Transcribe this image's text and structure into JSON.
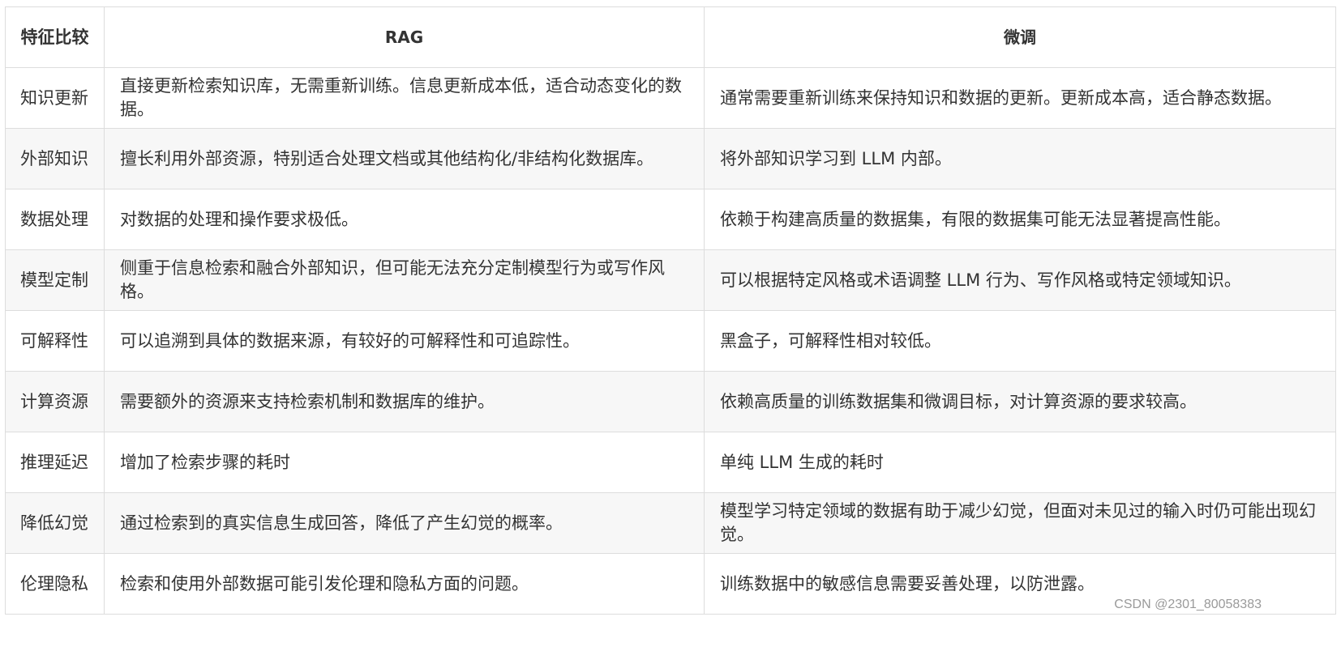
{
  "table": {
    "headers": [
      "特征比较",
      "RAG",
      "微调"
    ],
    "rows": [
      {
        "feature": "知识更新",
        "rag": "直接更新检索知识库，无需重新训练。信息更新成本低，适合动态变化的数据。",
        "ft": "通常需要重新训练来保持知识和数据的更新。更新成本高，适合静态数据。"
      },
      {
        "feature": "外部知识",
        "rag": "擅长利用外部资源，特别适合处理文档或其他结构化/非结构化数据库。",
        "ft": "将外部知识学习到 LLM 内部。"
      },
      {
        "feature": "数据处理",
        "rag": "对数据的处理和操作要求极低。",
        "ft": "依赖于构建高质量的数据集，有限的数据集可能无法显著提高性能。"
      },
      {
        "feature": "模型定制",
        "rag": "侧重于信息检索和融合外部知识，但可能无法充分定制模型行为或写作风格。",
        "ft": "可以根据特定风格或术语调整 LLM 行为、写作风格或特定领域知识。"
      },
      {
        "feature": "可解释性",
        "rag": "可以追溯到具体的数据来源，有较好的可解释性和可追踪性。",
        "ft": "黑盒子，可解释性相对较低。"
      },
      {
        "feature": "计算资源",
        "rag": "需要额外的资源来支持检索机制和数据库的维护。",
        "ft": "依赖高质量的训练数据集和微调目标，对计算资源的要求较高。"
      },
      {
        "feature": "推理延迟",
        "rag": "增加了检索步骤的耗时",
        "ft": "单纯 LLM 生成的耗时"
      },
      {
        "feature": "降低幻觉",
        "rag": "通过检索到的真实信息生成回答，降低了产生幻觉的概率。",
        "ft": "模型学习特定领域的数据有助于减少幻觉，但面对未见过的输入时仍可能出现幻觉。"
      },
      {
        "feature": "伦理隐私",
        "rag": "检索和使用外部数据可能引发伦理和隐私方面的问题。",
        "ft": "训练数据中的敏感信息需要妥善处理，以防泄露。"
      }
    ]
  },
  "watermark": "CSDN @2301_80058383"
}
